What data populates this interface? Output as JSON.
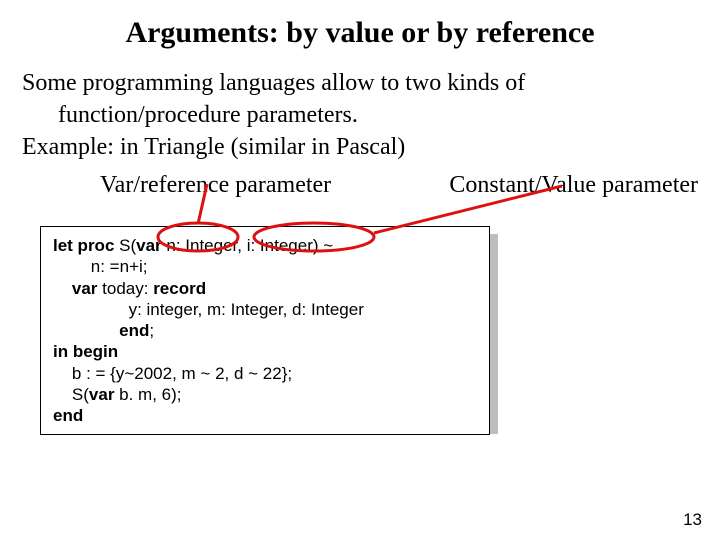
{
  "title": "Arguments: by value or by reference",
  "body": {
    "p1a": "Some programming languages allow to two kinds of",
    "p1b": "function/procedure parameters.",
    "p2": "Example: in Triangle (similar in Pascal)"
  },
  "labels": {
    "var_ref": "Var/reference parameter",
    "const_val": "Constant/Value parameter"
  },
  "code": {
    "l1a": "let proc ",
    "l1b": "S(",
    "l1c": "var ",
    "l1d": "n: Integer, i: Integer) ~",
    "l2": "        n: =n+i;",
    "l3a": "    var ",
    "l3b": "today: ",
    "l3c": "record",
    "l4": "                y: integer, m: Integer, d: Integer",
    "l5a": "              ",
    "l5b": "end",
    "l5c": ";",
    "l6": "in begin",
    "l7": "    b : = {y~2002, m ~ 2, d ~ 22};",
    "l8a": "    S(",
    "l8b": "var ",
    "l8c": "b. m, 6);",
    "l9": "end"
  },
  "page_number": "13"
}
